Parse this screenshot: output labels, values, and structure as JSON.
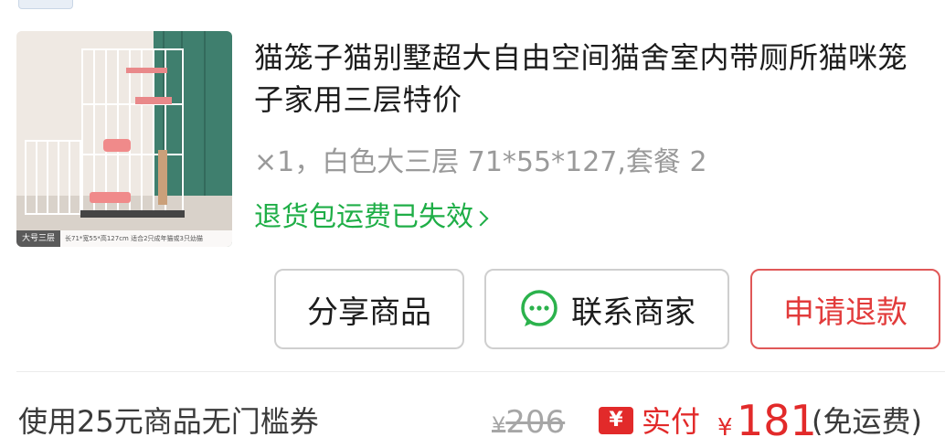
{
  "order_item": {
    "image_badge": "大号三层",
    "image_caption": "长71*宽55*高127cm  适合2只成年猫或3只幼猫",
    "title": "猫笼子猫别墅超大自由空间猫舍室内带厕所猫咪笼子家用三层特价",
    "spec": "×1，白色大三层 71*55*127,套餐 2",
    "return_status": "退货包运费已失效"
  },
  "actions": {
    "share_label": "分享商品",
    "contact_label": "联系商家",
    "refund_label": "申请退款"
  },
  "icons": {
    "chat": "chat-bubble-icon",
    "chevron": "chevron-right-icon",
    "payment": "yen-pay-icon"
  },
  "summary": {
    "coupon_text": "使用25元商品无门槛券",
    "original_currency": "¥",
    "original_price": "206",
    "pay_icon_glyph": "¥",
    "pay_label": "实付",
    "pay_currency": "¥",
    "pay_amount": "181",
    "shipping_note": "(免运费)"
  },
  "colors": {
    "accent_red": "#e22a2a",
    "return_green": "#1fae47",
    "chat_green": "#2bb24c",
    "muted_gray": "#9a9a9a"
  }
}
